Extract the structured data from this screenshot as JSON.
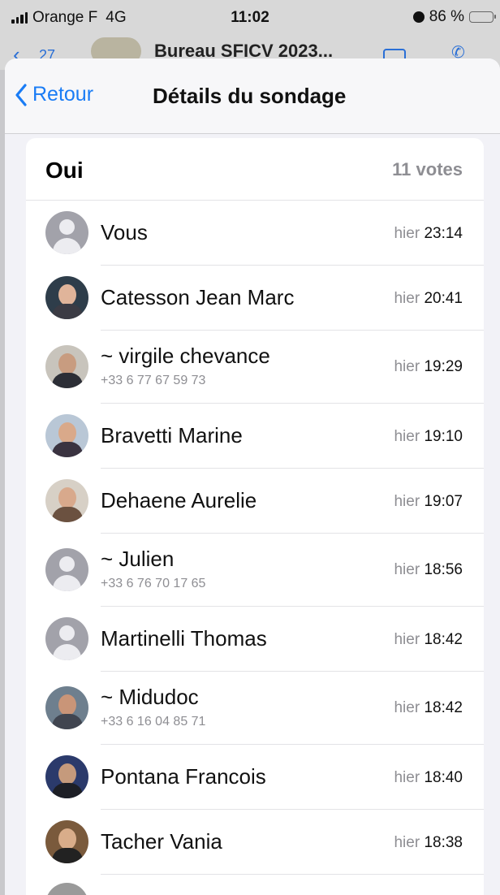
{
  "status_bar": {
    "carrier": "Orange F",
    "network": "4G",
    "time": "11:02",
    "battery": "86 %",
    "battery_level": 0.86
  },
  "chat_header": {
    "back_count": "27",
    "title": "Bureau SFICV 2023..."
  },
  "nav": {
    "back_label": "Retour",
    "title": "Détails du sondage"
  },
  "poll": {
    "option": "Oui",
    "votes": "11 votes",
    "voters": [
      {
        "name": "Vous",
        "phone": "",
        "day": "hier",
        "time": "23:14"
      },
      {
        "name": "Catesson Jean Marc",
        "phone": "",
        "day": "hier",
        "time": "20:41"
      },
      {
        "name": "~ virgile chevance",
        "phone": "+33 6 77 67 59 73",
        "day": "hier",
        "time": "19:29"
      },
      {
        "name": "Bravetti Marine",
        "phone": "",
        "day": "hier",
        "time": "19:10"
      },
      {
        "name": "Dehaene Aurelie",
        "phone": "",
        "day": "hier",
        "time": "19:07"
      },
      {
        "name": "~ Julien",
        "phone": "+33 6 76 70 17 65",
        "day": "hier",
        "time": "18:56"
      },
      {
        "name": "Martinelli Thomas",
        "phone": "",
        "day": "hier",
        "time": "18:42"
      },
      {
        "name": "~ Midudoc",
        "phone": "+33 6 16 04 85 71",
        "day": "hier",
        "time": "18:42"
      },
      {
        "name": "Pontana Francois",
        "phone": "",
        "day": "hier",
        "time": "18:40"
      },
      {
        "name": "Tacher Vania",
        "phone": "",
        "day": "hier",
        "time": "18:38"
      }
    ]
  },
  "colors": {
    "accent": "#1a7cf5",
    "secondary_text": "#8e8e93",
    "battery": "#f5c400"
  }
}
